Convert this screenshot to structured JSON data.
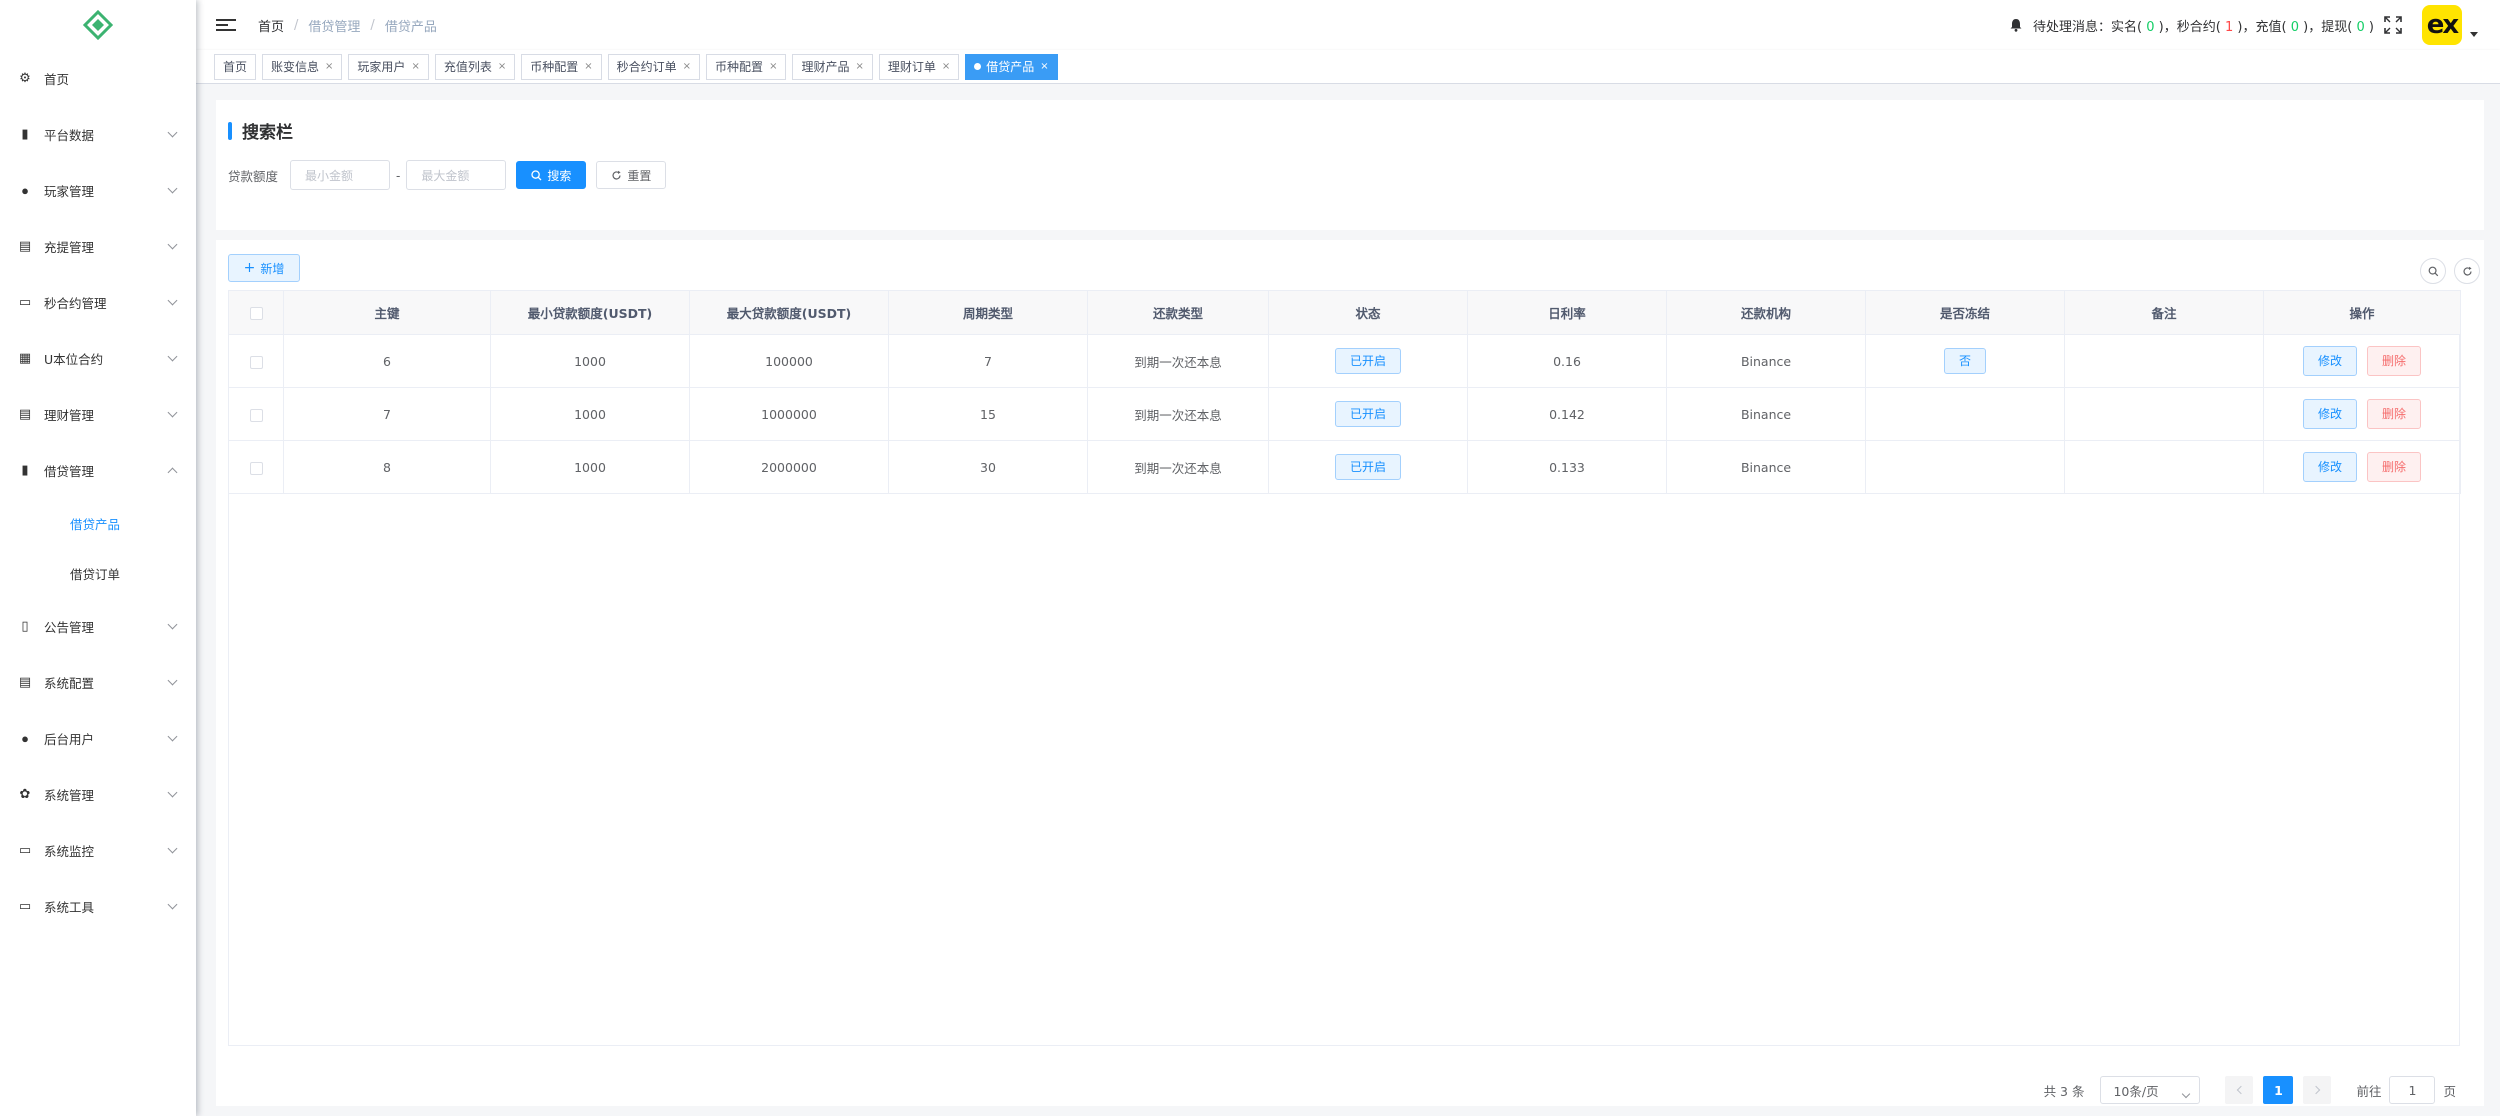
{
  "sidebar": {
    "items": [
      {
        "label": "首页",
        "icon": "dashboard-icon",
        "has_children": false
      },
      {
        "label": "平台数据",
        "icon": "chart-icon",
        "has_children": true
      },
      {
        "label": "玩家管理",
        "icon": "user-icon",
        "has_children": true
      },
      {
        "label": "充提管理",
        "icon": "clipboard-icon",
        "has_children": true
      },
      {
        "label": "秒合约管理",
        "icon": "monitor-icon",
        "has_children": true
      },
      {
        "label": "U本位合约",
        "icon": "grid-icon",
        "has_children": true
      },
      {
        "label": "理财管理",
        "icon": "document-icon",
        "has_children": true
      },
      {
        "label": "借贷管理",
        "icon": "book-icon",
        "has_children": true,
        "expanded": true
      }
    ],
    "sub_items": [
      {
        "label": "借贷产品",
        "active": true
      },
      {
        "label": "借贷订单",
        "active": false
      }
    ],
    "items_after": [
      {
        "label": "公告管理",
        "icon": "read-icon"
      },
      {
        "label": "系统配置",
        "icon": "config-icon"
      },
      {
        "label": "后台用户",
        "icon": "users-icon"
      },
      {
        "label": "系统管理",
        "icon": "gear-icon"
      },
      {
        "label": "系统监控",
        "icon": "monitor-icon"
      },
      {
        "label": "系统工具",
        "icon": "toolbox-icon"
      }
    ]
  },
  "header": {
    "breadcrumb": [
      "首页",
      "借贷管理",
      "借贷产品"
    ],
    "notice_prefix": "待处理消息：",
    "notice": [
      {
        "label": "实名",
        "count": "0",
        "color": "green"
      },
      {
        "label": "秒合约",
        "count": "1",
        "color": "red"
      },
      {
        "label": "充值",
        "count": "0",
        "color": "green"
      },
      {
        "label": "提现",
        "count": "0",
        "color": "green"
      }
    ],
    "avatar_text": "ex"
  },
  "tags": [
    {
      "label": "首页",
      "closable": false,
      "active": false
    },
    {
      "label": "账变信息",
      "closable": true,
      "active": false
    },
    {
      "label": "玩家用户",
      "closable": true,
      "active": false
    },
    {
      "label": "充值列表",
      "closable": true,
      "active": false
    },
    {
      "label": "币种配置",
      "closable": true,
      "active": false
    },
    {
      "label": "秒合约订单",
      "closable": true,
      "active": false
    },
    {
      "label": "币种配置",
      "closable": true,
      "active": false
    },
    {
      "label": "理财产品",
      "closable": true,
      "active": false
    },
    {
      "label": "理财订单",
      "closable": true,
      "active": false
    },
    {
      "label": "借贷产品",
      "closable": true,
      "active": true
    }
  ],
  "search": {
    "title": "搜索栏",
    "label": "贷款额度",
    "min_placeholder": "最小金额",
    "max_placeholder": "最大金额",
    "search_btn": "搜索",
    "reset_btn": "重置"
  },
  "table": {
    "add_btn": "新增",
    "columns": [
      "主键",
      "最小贷款额度(USDT)",
      "最大贷款额度(USDT)",
      "周期类型",
      "还款类型",
      "状态",
      "日利率",
      "还款机构",
      "是否冻结",
      "备注",
      "操作"
    ],
    "rows": [
      {
        "id": "6",
        "min": "1000",
        "max": "100000",
        "cycle": "7",
        "repay": "到期一次还本息",
        "status": "已开启",
        "rate": "0.16",
        "org": "Binance",
        "frozen": "否",
        "remark": ""
      },
      {
        "id": "7",
        "min": "1000",
        "max": "1000000",
        "cycle": "15",
        "repay": "到期一次还本息",
        "status": "已开启",
        "rate": "0.142",
        "org": "Binance",
        "frozen": "",
        "remark": ""
      },
      {
        "id": "8",
        "min": "1000",
        "max": "2000000",
        "cycle": "30",
        "repay": "到期一次还本息",
        "status": "已开启",
        "rate": "0.133",
        "org": "Binance",
        "frozen": "",
        "remark": ""
      }
    ],
    "edit_label": "修改",
    "delete_label": "删除"
  },
  "pagination": {
    "total": "共 3 条",
    "page_size": "10条/页",
    "current": "1",
    "goto_prefix": "前往",
    "goto_value": "1",
    "goto_suffix": "页"
  },
  "colors": {
    "primary": "#1890ff",
    "danger": "#f56c6c",
    "success": "#13ce66",
    "active_tag": "#3a9cf5",
    "avatar_bg": "#ffe400"
  }
}
